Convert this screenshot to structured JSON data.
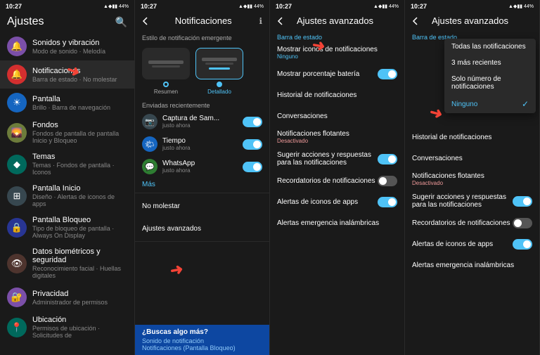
{
  "panels": [
    {
      "id": "panel1",
      "time": "10:27",
      "statusIcons": "▲ ◆ ▮▮ 44%",
      "title": "Ajustes",
      "showSearch": true,
      "items": [
        {
          "id": "sonidos",
          "iconBg": "icon-purple",
          "iconChar": "🔔",
          "label": "Sonidos y vibración",
          "sub": "Modo de sonido · Melodía",
          "active": false
        },
        {
          "id": "notificaciones",
          "iconBg": "icon-red",
          "iconChar": "🔔",
          "label": "Notificaciones",
          "sub": "Barra de estado · No molestar",
          "active": true
        },
        {
          "id": "pantalla",
          "iconBg": "icon-blue",
          "iconChar": "☀",
          "label": "Pantalla",
          "sub": "Brillo · Barra de navegación",
          "active": false
        },
        {
          "id": "fondos",
          "iconBg": "icon-olive",
          "iconChar": "🌄",
          "label": "Fondos",
          "sub": "Fondos de pantalla de pantalla Inicio y Bloqueo",
          "active": false
        },
        {
          "id": "temas",
          "iconBg": "icon-teal",
          "iconChar": "◆",
          "label": "Temas",
          "sub": "Temas · Fondos de pantalla · Iconos",
          "active": false
        },
        {
          "id": "pantallainicio",
          "iconBg": "icon-dark",
          "iconChar": "⊞",
          "label": "Pantalla Inicio",
          "sub": "Diseño · Alertas de iconos de apps",
          "active": false
        },
        {
          "id": "pantallab",
          "iconBg": "icon-indigo",
          "iconChar": "🔒",
          "label": "Pantalla Bloqueo",
          "sub": "Tipo de bloqueo de pantalla · Always On Display",
          "active": false
        },
        {
          "id": "datos",
          "iconBg": "icon-brown",
          "iconChar": "👁",
          "label": "Datos biométricos y seguridad",
          "sub": "Reconocimiento facial · Huellas digitales",
          "active": false
        },
        {
          "id": "privacidad",
          "iconBg": "icon-purple",
          "iconChar": "🔐",
          "label": "Privacidad",
          "sub": "Administrador de permisos",
          "active": false
        },
        {
          "id": "ubicacion",
          "iconBg": "icon-teal",
          "iconChar": "📍",
          "label": "Ubicación",
          "sub": "Permisos de ubicación · Solicitudes de",
          "active": false
        }
      ]
    },
    {
      "id": "panel2",
      "time": "10:27",
      "statusIcons": "▲ ◆ ▮▮ 44%",
      "backLabel": "Notificaciones",
      "showInfo": true,
      "notifStyleLabel": "Estilo de notificación emergente",
      "styleOptions": [
        {
          "id": "resumen",
          "label": "Resumen",
          "selected": false
        },
        {
          "id": "detallado",
          "label": "Detallado",
          "selected": true
        }
      ],
      "recentlyLabel": "Enviadas recientemente",
      "recentApps": [
        {
          "id": "captura",
          "iconBg": "#37474f",
          "iconChar": "📷",
          "name": "Captura de Sam...",
          "time": "justo ahora",
          "toggle": true
        },
        {
          "id": "tiempo",
          "iconBg": "#1565c0",
          "iconChar": "🌤",
          "name": "Tiempo",
          "time": "justo ahora",
          "toggle": true
        },
        {
          "id": "whatsapp",
          "iconBg": "#2e7d32",
          "iconChar": "💬",
          "name": "WhatsApp",
          "time": "justo ahora",
          "toggle": true
        }
      ],
      "masLabel": "Más",
      "doNotDisturbLabel": "No molestar",
      "advancedLabel": "Ajustes avanzados",
      "buscaTitle": "¿Buscas algo más?",
      "buscaLinks": [
        "Sonido de notificación",
        "Notificaciones (Pantalla Bloqueo)"
      ]
    },
    {
      "id": "panel3",
      "time": "10:27",
      "statusIcons": "▲ ◆ ▮▮ 44%",
      "backLabel": "Ajustes avanzados",
      "barraLabel": "Barra de estado",
      "items": [
        {
          "id": "mostrar-iconos",
          "text": "Mostrar iconos de notificaciones",
          "sub": "Ninguno",
          "subColor": "blue",
          "toggle": false,
          "hasArrow": false
        },
        {
          "id": "mostrar-pct",
          "text": "Mostrar porcentaje batería",
          "sub": "",
          "toggle": true,
          "toggleOn": true
        },
        {
          "id": "historial",
          "text": "Historial de notificaciones",
          "sub": "",
          "toggle": false,
          "hasArrow": false
        },
        {
          "id": "conversaciones",
          "text": "Conversaciones",
          "sub": "",
          "toggle": false,
          "hasArrow": false
        },
        {
          "id": "flotantes",
          "text": "Notificaciones flotantes",
          "sub": "Desactivado",
          "subColor": "red",
          "toggle": false,
          "hasArrow": false
        },
        {
          "id": "sugerir",
          "text": "Sugerir acciones y respuestas para las notificaciones",
          "sub": "",
          "toggle": true,
          "toggleOn": true
        },
        {
          "id": "recordatorios",
          "text": "Recordatorios de notificaciones",
          "sub": "",
          "toggle": true,
          "toggleOn": false
        },
        {
          "id": "alertas-iconos",
          "text": "Alertas de iconos de apps",
          "sub": "",
          "toggle": true,
          "toggleOn": true
        },
        {
          "id": "alertas-emergencia",
          "text": "Alertas emergencia inalámbricas",
          "sub": "",
          "toggle": false,
          "hasArrow": false
        }
      ]
    },
    {
      "id": "panel4",
      "time": "10:27",
      "statusIcons": "▲ ◆ ▮▮ 44%",
      "backLabel": "Ajustes avanzados",
      "barraLabel": "Barra de estado",
      "dropdownOptions": [
        {
          "id": "todas",
          "label": "Todas las notificaciones",
          "selected": false
        },
        {
          "id": "tres",
          "label": "3 más recientes",
          "selected": false
        },
        {
          "id": "solo",
          "label": "Solo número de notificaciones",
          "selected": false
        },
        {
          "id": "ninguno",
          "label": "Ninguno",
          "selected": true
        }
      ],
      "items": [
        {
          "id": "historial2",
          "text": "Historial de notificaciones",
          "sub": "",
          "toggle": false
        },
        {
          "id": "conversaciones2",
          "text": "Conversaciones",
          "sub": "",
          "toggle": false
        },
        {
          "id": "flotantes2",
          "text": "Notificaciones flotantes",
          "sub": "Desactivado",
          "subColor": "red",
          "toggle": false
        },
        {
          "id": "sugerir2",
          "text": "Sugerir acciones y respuestas para las notificaciones",
          "sub": "",
          "toggle": true,
          "toggleOn": true
        },
        {
          "id": "recordatorios2",
          "text": "Recordatorios de notificaciones",
          "sub": "",
          "toggle": true,
          "toggleOn": false
        },
        {
          "id": "alertas-iconos2",
          "text": "Alertas de iconos de apps",
          "sub": "",
          "toggle": true,
          "toggleOn": true
        },
        {
          "id": "alertas-emergencia2",
          "text": "Alertas emergencia inalámbricas",
          "sub": "",
          "toggle": false
        }
      ]
    }
  ]
}
